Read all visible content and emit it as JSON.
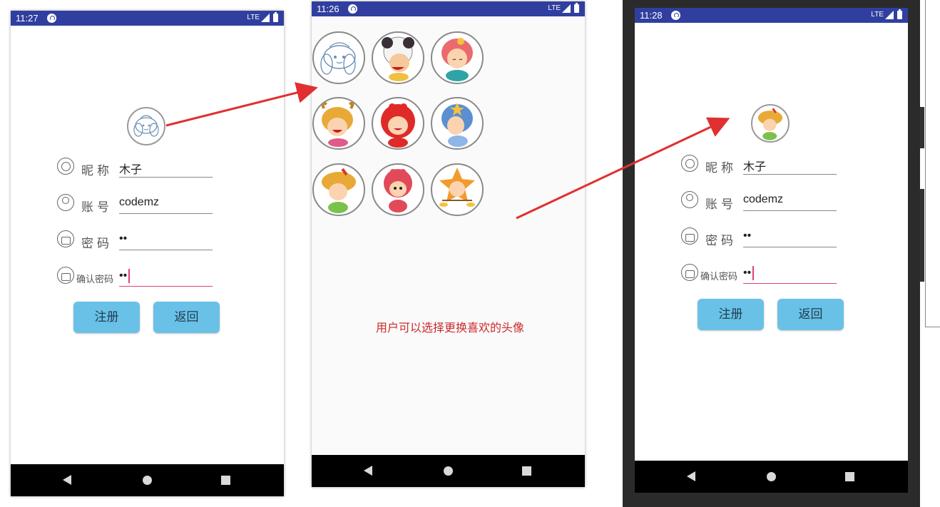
{
  "screen1": {
    "status": {
      "time": "11:27",
      "network": "LTE"
    },
    "form": {
      "nickname_label": "昵称",
      "nickname_value": "木子",
      "account_label": "账号",
      "account_value": "codemz",
      "password_label": "密码",
      "password_value": "••",
      "confirm_label": "确认密码",
      "confirm_value": "••"
    },
    "buttons": {
      "register": "注册",
      "back": "返回"
    }
  },
  "screen2": {
    "status": {
      "time": "11:26",
      "network": "LTE"
    },
    "caption": "用户可以选择更换喜欢的头像",
    "avatars": [
      "cinnamoroll",
      "aries",
      "virgo",
      "taurus",
      "cancer",
      "aquarius",
      "sagittarius",
      "scorpio",
      "libra"
    ]
  },
  "screen3": {
    "status": {
      "time": "11:28",
      "network": "LTE"
    },
    "form": {
      "nickname_label": "昵称",
      "nickname_value": "木子",
      "account_label": "账号",
      "account_value": "codemz",
      "password_label": "密码",
      "password_value": "••",
      "confirm_label": "确认密码",
      "confirm_value": "••"
    },
    "buttons": {
      "register": "注册",
      "back": "返回"
    }
  },
  "colors": {
    "statusbar": "#303f9f",
    "button": "#6ac1e7",
    "arrow": "#e03030",
    "accent": "#e0407a"
  }
}
